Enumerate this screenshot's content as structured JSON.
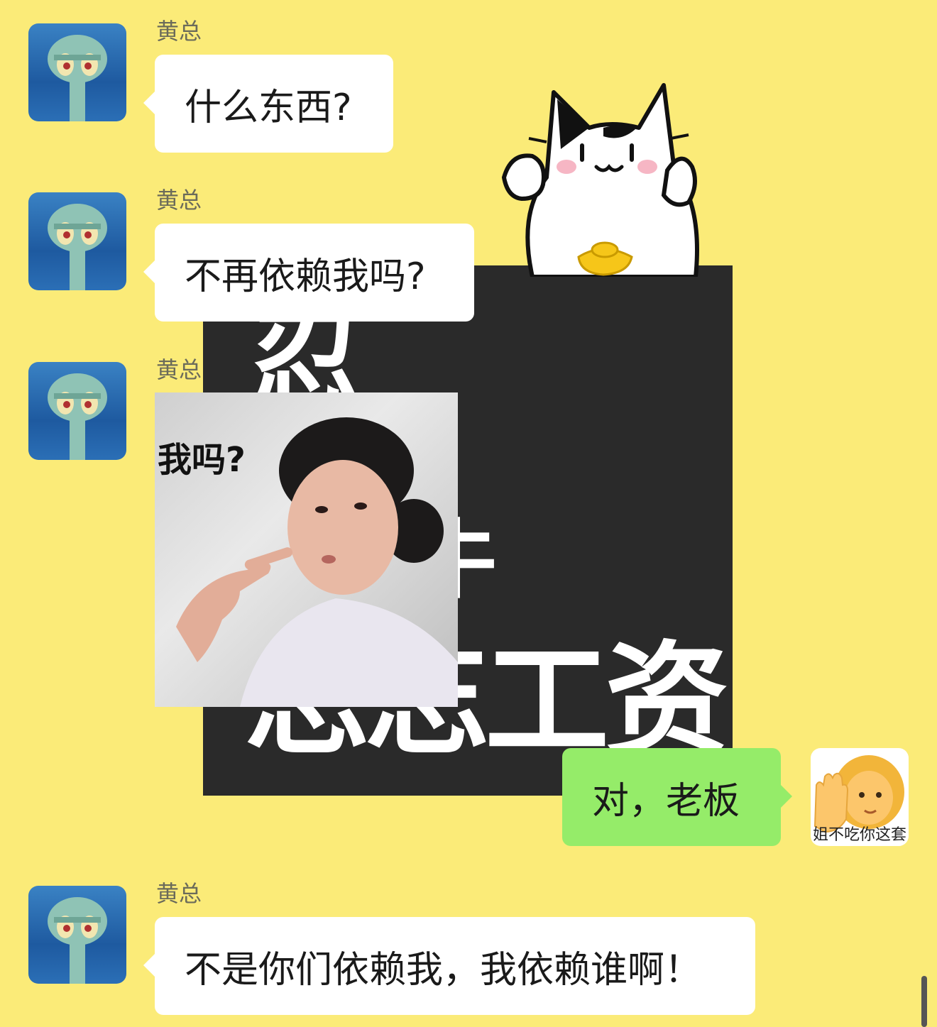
{
  "wallpaper": {
    "char_1": "忍",
    "char_2": "牛",
    "char_3": "忘忘工资"
  },
  "messages": [
    {
      "sender": "黄总",
      "type": "text",
      "text": "什么东西?"
    },
    {
      "sender": "黄总",
      "type": "text",
      "text": "不再依赖我吗?"
    },
    {
      "sender": "黄总",
      "type": "sticker",
      "sticker_text": "我吗?"
    },
    {
      "sender": "self",
      "type": "text",
      "text": "对，老板"
    },
    {
      "sender": "黄总",
      "type": "text",
      "text": "不是你们依赖我，我依赖谁啊！"
    }
  ],
  "self_avatar": {
    "caption": "姐不吃你这套",
    "icon": "woman-raising-hand-emoji"
  },
  "colors": {
    "background": "#fbeb78",
    "incoming_bubble": "#ffffff",
    "outgoing_bubble": "#95ec69",
    "sender_name": "#6b6b5a"
  }
}
